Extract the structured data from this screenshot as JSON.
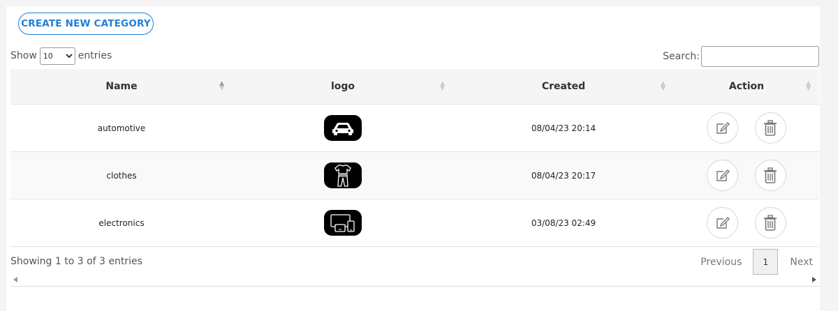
{
  "toolbar": {
    "create_label": "CREATE NEW CATEGORY"
  },
  "length": {
    "show_label": "Show",
    "selected": "10",
    "entries_label": "entries"
  },
  "search": {
    "label": "Search:",
    "placeholder": ""
  },
  "table": {
    "columns": [
      "Name",
      "logo",
      "Created",
      "Action"
    ],
    "rows": [
      {
        "name": "automotive",
        "logo_icon": "car-icon",
        "created": "08/04/23 20:14"
      },
      {
        "name": "clothes",
        "logo_icon": "clothes-icon",
        "created": "08/04/23 20:17"
      },
      {
        "name": "electronics",
        "logo_icon": "devices-icon",
        "created": "03/08/23 02:49"
      }
    ]
  },
  "footer": {
    "info": "Showing 1 to 3 of 3 entries"
  },
  "pagination": {
    "previous": "Previous",
    "current": "1",
    "next": "Next"
  },
  "colors": {
    "accent": "#1f7fd6",
    "logo_bg": "#000000"
  }
}
